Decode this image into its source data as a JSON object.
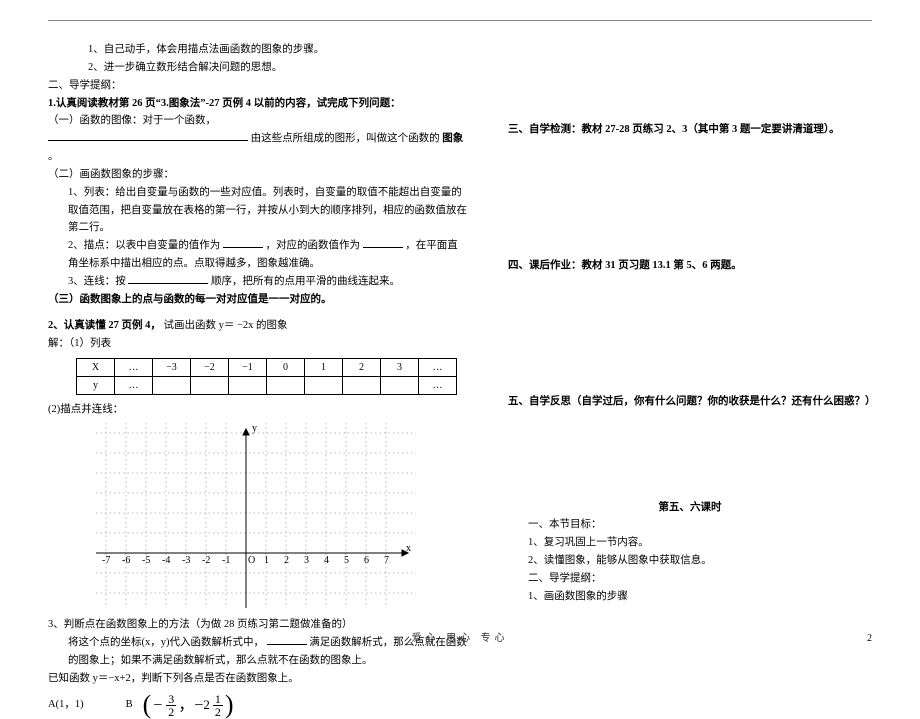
{
  "intro": {
    "item1": "1、自己动手，体会用描点法画函数的图象的步骤。",
    "item2": "2、进一步确立数形结合解决问题的思想。",
    "tip_head": "二、导学提纲：",
    "task1_head": "1.认真阅读教材第 26 页“3.图象法”-27 页例 4 以前的内容，试完成下列问题：",
    "sub1_a": "（一）函数的图像：对于一个函数，",
    "sub1_b": "由这些点所组成的图形，叫做这个函数的",
    "sub1_c": "图象",
    "sub1_d": "。",
    "sub2_head": "（二）画函数图象的步骤：",
    "s2_1": "1、列表：给出自变量与函数的一些对应值。列表时，自变量的取值不能超出自变量的取值范围，把自变量放在表格的第一行，并按从小到大的顺序排列，相应的函数值放在第二行。",
    "s2_2a": "2、描点：以表中自变量的值作为",
    "s2_2b": "，对应的函数值作为",
    "s2_2c": "，在平面直角坐标系中描出相应的点。点取得越多，图象越准确。",
    "s2_3a": "3、连线：按",
    "s2_3b": "顺序，把所有的点用平滑的曲线连起来。",
    "sub3": "（三）函数图象上的点与函数的每一对对应值是一一对应的。"
  },
  "ex2": {
    "head_a": "2、认真读懂 27 页例 4，",
    "head_b": "试画出函数 y＝ −2x 的图象",
    "step1": "解：（1）列表",
    "step2": "(2)描点并连线：",
    "row_x": "X",
    "row_y": "y",
    "dots": "…",
    "cells": [
      "−3",
      "−2",
      "−1",
      "0",
      "1",
      "2",
      "3"
    ]
  },
  "ex3": {
    "l1": "3、判断点在函数图象上的方法（为做 28 页练习第二题做准备的）",
    "l2a": "将这个点的坐标(x，y)代入函数解析式中，",
    "l2b": "满足函数解析式，那么点就在函数的图象上；如果不满足函数解析式，那么点就不在函数的图象上。",
    "l3": "已知函数 y＝−x+2，判断下列各点是否在函数图象上。",
    "optA_lbl": "A(1，1)",
    "optB_lbl": "B"
  },
  "fracs": {
    "n1": "3",
    "d1": "2",
    "w2": "2",
    "n2": "1",
    "d2": "2"
  },
  "axes": {
    "ticks": [
      "-7",
      "-6",
      "-5",
      "-4",
      "-3",
      "-2",
      "-1",
      "O",
      "1",
      "2",
      "3",
      "4",
      "5",
      "6",
      "7"
    ],
    "y": "y",
    "x": "x"
  },
  "right": {
    "sec3": "三、自学检测：教材 27-28 页练习 2、3（其中第 3 题一定要讲清道理）。",
    "sec4": "四、课后作业：教材 31 页习题 13.1 第 5、6 两题。",
    "sec5": "五、自学反思（自学过后，你有什么问题？你的收获是什么？还有什么困惑？）",
    "title56": "第五、六课时",
    "h1": "一、本节目标：",
    "h1_1": "1、复习巩固上一节内容。",
    "h1_2": "2、读懂图象，能够从图象中获取信息。",
    "h2": "二、导学提纲：",
    "h2_1": "1、画函数图象的步骤"
  },
  "footer": "爱心   用心   专心",
  "pageno": "2"
}
